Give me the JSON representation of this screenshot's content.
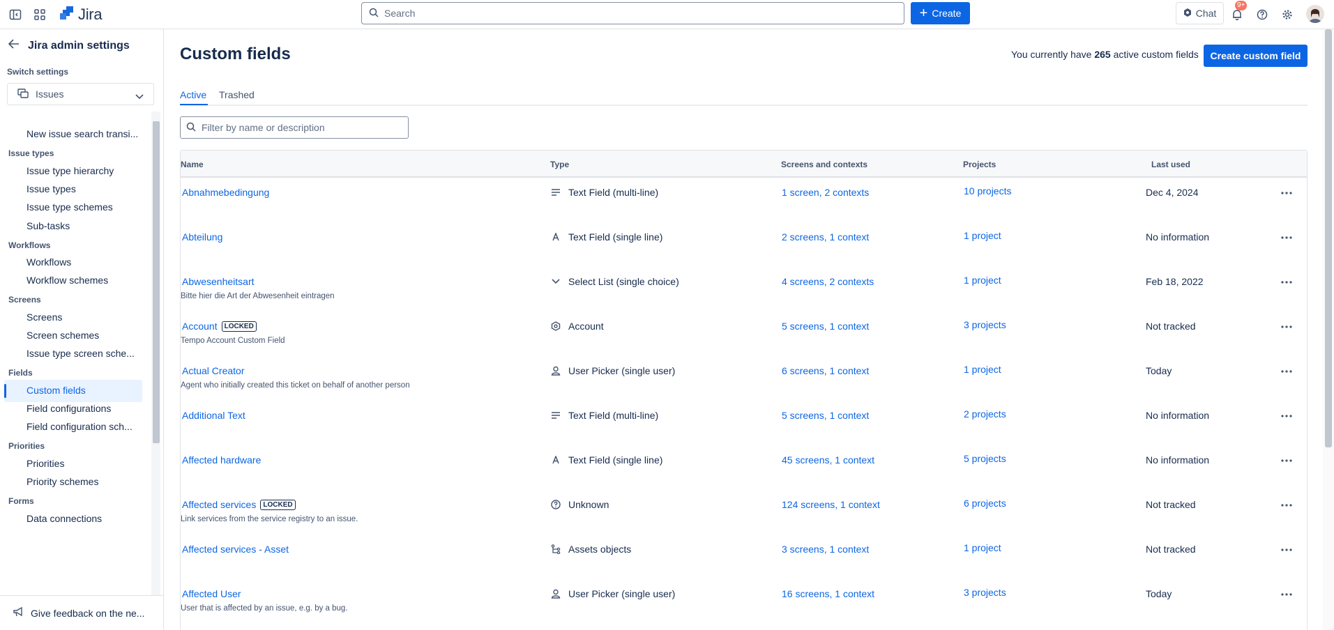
{
  "topbar": {
    "app_name": "Jira",
    "search_placeholder": "Search",
    "create_label": "Create",
    "chat_label": "Chat",
    "notification_count": "9+",
    "icons": [
      "sidebar-toggle-icon",
      "app-switcher-icon",
      "jira-logo-icon",
      "search-icon",
      "plus-icon",
      "chat-icon",
      "bell-icon",
      "help-icon",
      "settings-icon"
    ]
  },
  "sidebar": {
    "title": "Jira admin settings",
    "switch_label": "Switch settings",
    "switch_value": "Issues",
    "items": [
      {
        "type": "item",
        "label": "New issue search transi..."
      },
      {
        "type": "section",
        "label": "Issue types"
      },
      {
        "type": "item",
        "label": "Issue type hierarchy"
      },
      {
        "type": "item",
        "label": "Issue types"
      },
      {
        "type": "item",
        "label": "Issue type schemes"
      },
      {
        "type": "item",
        "label": "Sub-tasks"
      },
      {
        "type": "section",
        "label": "Workflows"
      },
      {
        "type": "item",
        "label": "Workflows"
      },
      {
        "type": "item",
        "label": "Workflow schemes"
      },
      {
        "type": "section",
        "label": "Screens"
      },
      {
        "type": "item",
        "label": "Screens"
      },
      {
        "type": "item",
        "label": "Screen schemes"
      },
      {
        "type": "item",
        "label": "Issue type screen sche..."
      },
      {
        "type": "section",
        "label": "Fields"
      },
      {
        "type": "item",
        "label": "Custom fields",
        "active": true
      },
      {
        "type": "item",
        "label": "Field configurations"
      },
      {
        "type": "item",
        "label": "Field configuration sch..."
      },
      {
        "type": "section",
        "label": "Priorities"
      },
      {
        "type": "item",
        "label": "Priorities"
      },
      {
        "type": "item",
        "label": "Priority schemes"
      },
      {
        "type": "section",
        "label": "Forms"
      },
      {
        "type": "item",
        "label": "Data connections"
      }
    ],
    "footer_label": "Give feedback on the ne..."
  },
  "main": {
    "title": "Custom fields",
    "count_prefix": "You currently have ",
    "count_value": "265",
    "count_suffix": " active custom fields",
    "create_button": "Create custom field",
    "tabs": [
      "Active",
      "Trashed"
    ],
    "filter_placeholder": "Filter by name or description",
    "columns": [
      "Name",
      "Type",
      "Screens and contexts",
      "Projects",
      "Last used"
    ],
    "rows": [
      {
        "name": "Abnahmebedingung",
        "locked": false,
        "desc": "",
        "type_icon": "multiline-text-icon",
        "type": "Text Field (multi-line)",
        "screens": "1 screen,  2 contexts",
        "projects": "10 projects",
        "last_used": "Dec 4, 2024"
      },
      {
        "name": "Abteilung",
        "locked": false,
        "desc": "",
        "type_icon": "single-line-text-icon",
        "type": "Text Field (single line)",
        "screens": "2 screens,  1 context",
        "projects": "1 project",
        "last_used": "No information"
      },
      {
        "name": "Abwesenheitsart",
        "locked": false,
        "desc": "Bitte hier die Art der Abwesenheit eintragen",
        "type_icon": "select-list-icon",
        "type": "Select List (single choice)",
        "screens": "4 screens,  2 contexts",
        "projects": "1 project",
        "last_used": "Feb 18, 2022"
      },
      {
        "name": "Account",
        "locked": true,
        "desc": "Tempo Account Custom Field",
        "type_icon": "account-hexagon-icon",
        "type": "Account",
        "screens": "5 screens,  1 context",
        "projects": "3 projects",
        "last_used": "Not tracked"
      },
      {
        "name": "Actual Creator",
        "locked": false,
        "desc": "Agent who initially created this ticket on behalf of another person",
        "type_icon": "user-picker-icon",
        "type": "User Picker (single user)",
        "screens": "6 screens,  1 context",
        "projects": "1 project",
        "last_used": "Today"
      },
      {
        "name": "Additional Text",
        "locked": false,
        "desc": "",
        "type_icon": "multiline-text-icon",
        "type": "Text Field (multi-line)",
        "screens": "5 screens,  1 context",
        "projects": "2 projects",
        "last_used": "No information"
      },
      {
        "name": "Affected hardware",
        "locked": false,
        "desc": "",
        "type_icon": "single-line-text-icon",
        "type": "Text Field (single line)",
        "screens": "45 screens,  1 context",
        "projects": "5 projects",
        "last_used": "No information"
      },
      {
        "name": "Affected services",
        "locked": true,
        "desc": "Link services from the service registry to an issue.",
        "type_icon": "unknown-question-icon",
        "type": "Unknown",
        "screens": "124 screens,  1 context",
        "projects": "6 projects",
        "last_used": "Not tracked"
      },
      {
        "name": "Affected services - Asset",
        "locked": false,
        "desc": "",
        "type_icon": "assets-objects-icon",
        "type": "Assets objects",
        "screens": "3 screens,  1 context",
        "projects": "1 project",
        "last_used": "Not tracked"
      },
      {
        "name": "Affected User",
        "locked": false,
        "desc": "User that is affected by an issue, e.g. by a bug.",
        "type_icon": "user-picker-icon",
        "type": "User Picker (single user)",
        "screens": "16 screens,  1 context",
        "projects": "3 projects",
        "last_used": "Today"
      }
    ],
    "locked_label": "LOCKED"
  }
}
